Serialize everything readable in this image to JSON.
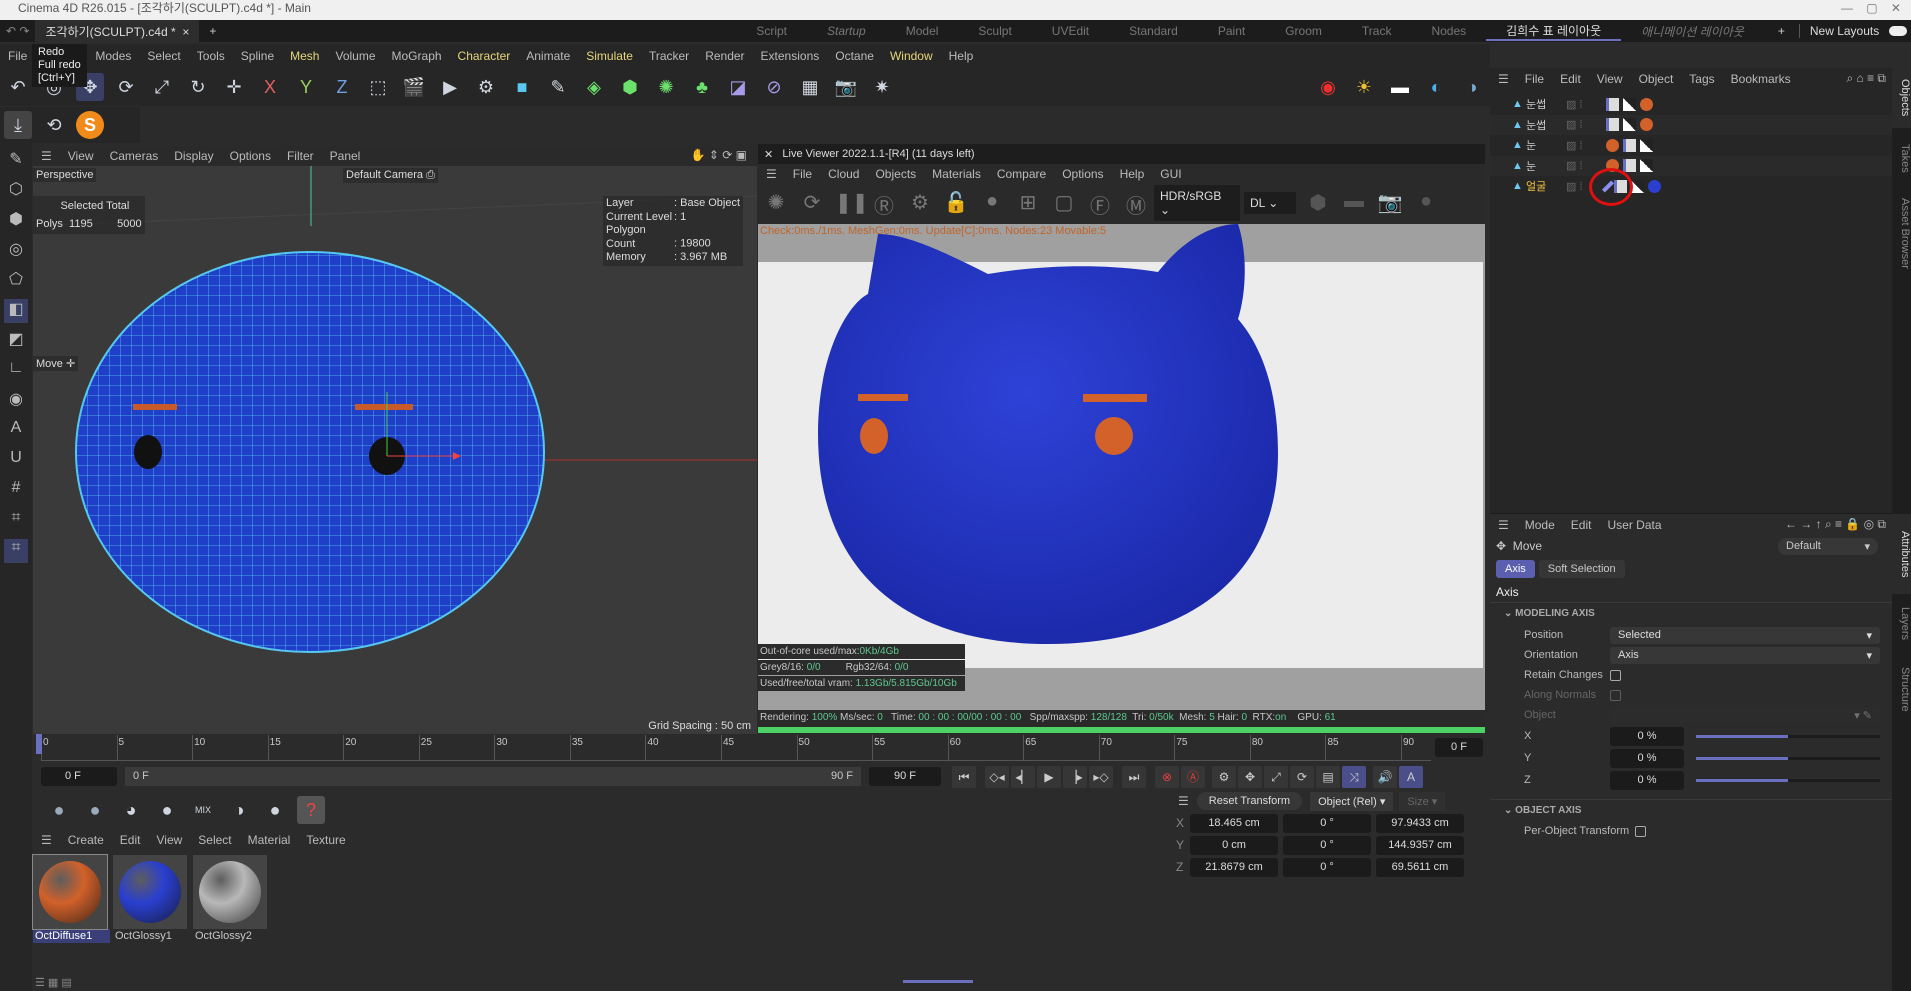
{
  "window": {
    "title": "Cinema 4D R26.015 - [조각하기(SCULPT).c4d *] - Main"
  },
  "doc_tab": {
    "label": "조각하기(SCULPT).c4d *",
    "close": "×",
    "add": "+"
  },
  "layouts": [
    "Script",
    "Startup",
    "Model",
    "Sculpt",
    "UVEdit",
    "Standard",
    "Paint",
    "Groom",
    "Track",
    "Nodes",
    "김희수 표 레이아웃",
    "애니메이션 레이아웃"
  ],
  "layout_active": "김희수 표 레이아웃",
  "new_layouts": "New Layouts",
  "tooltip": {
    "title": "Redo",
    "line1": "Full redo",
    "line2": "[Ctrl+Y]"
  },
  "menu": [
    {
      "label": "File"
    },
    {
      "label": "Create"
    },
    {
      "label": "Modes"
    },
    {
      "label": "Select"
    },
    {
      "label": "Tools"
    },
    {
      "label": "Spline"
    },
    {
      "label": "Mesh",
      "hl": true
    },
    {
      "label": "Volume"
    },
    {
      "label": "MoGraph"
    },
    {
      "label": "Character",
      "hl": true
    },
    {
      "label": "Animate"
    },
    {
      "label": "Simulate",
      "hl": true
    },
    {
      "label": "Tracker"
    },
    {
      "label": "Render"
    },
    {
      "label": "Extensions"
    },
    {
      "label": "Octane"
    },
    {
      "label": "Window",
      "hl": true
    },
    {
      "label": "Help"
    }
  ],
  "viewport": {
    "menu": [
      "View",
      "Cameras",
      "Display",
      "Options",
      "Filter",
      "Panel"
    ],
    "name": "Perspective",
    "camera": "Default Camera",
    "stats": {
      "header_selected": "Selected",
      "header_total": "Total",
      "row_label": "Polys",
      "selected": "1195",
      "total": "5000"
    },
    "info": [
      [
        "Layer",
        ": Base Object"
      ],
      [
        "Current Level",
        ": 1"
      ],
      [
        "Polygon Count",
        ": 19800"
      ],
      [
        "Memory",
        ": 3.967 MB"
      ]
    ],
    "tool": "Move",
    "grid_spacing": "Grid Spacing : 50 cm"
  },
  "live_viewer": {
    "title": "Live Viewer 2022.1.1-[R4] (11 days left)",
    "menu": [
      "File",
      "Cloud",
      "Objects",
      "Materials",
      "Compare",
      "Options",
      "Help",
      "GUI"
    ],
    "colorspace": "HDR/sRGB",
    "kernel": "DL",
    "status": "Check:0ms./1ms. MeshGen:0ms. Update[C]:0ms. Nodes:23 Movable:5",
    "mem": {
      "ooc_label": "Out-of-core used/max:",
      "ooc": "0Kb/4Gb",
      "grey_label": "Grey8/16: ",
      "grey": "0/0",
      "rgb_label": "Rgb32/64: ",
      "rgb": "0/0",
      "vram_label": "Used/free/total vram: ",
      "vram": "1.13Gb/5.815Gb/10Gb"
    },
    "stats": [
      [
        "Rendering: ",
        "100%"
      ],
      [
        " Ms/sec: ",
        "0"
      ],
      [
        "   Time: ",
        "00 : 00 : 00/00 : 00 : 00"
      ],
      [
        "   Spp/maxspp: ",
        "128/128"
      ],
      [
        "  Tri: ",
        "0/50k"
      ],
      [
        "  Mesh: ",
        "5"
      ],
      [
        " Hair: ",
        "0"
      ],
      [
        "  RTX:",
        "on"
      ],
      [
        "    GPU: ",
        "61"
      ]
    ],
    "progress": 100
  },
  "timeline": {
    "ticks": [
      "0",
      "5",
      "10",
      "15",
      "20",
      "25",
      "30",
      "35",
      "40",
      "45",
      "50",
      "55",
      "60",
      "65",
      "70",
      "75",
      "80",
      "85",
      "90"
    ],
    "current": "0 F",
    "start": "0 F",
    "range_start": "0 F",
    "range_end": "90 F",
    "end": "90 F"
  },
  "materials": {
    "menu": [
      "Create",
      "Edit",
      "View",
      "Select",
      "Material",
      "Texture"
    ],
    "items": [
      {
        "name": "OctDiffuse1",
        "color": "#d2612a",
        "selected": true
      },
      {
        "name": "OctGlossy1",
        "color": "#2a3fd0"
      },
      {
        "name": "OctGlossy2",
        "color": "#b8b8b8"
      }
    ]
  },
  "coords": {
    "reset": "Reset Transform",
    "mode": "Object (Rel)",
    "size": "Size",
    "rows": [
      {
        "axis": "X",
        "pos": "18.465 cm",
        "rot": "0 °",
        "scale": "97.9433 cm"
      },
      {
        "axis": "Y",
        "pos": "0 cm",
        "rot": "0 °",
        "scale": "144.9357 cm"
      },
      {
        "axis": "Z",
        "pos": "21.8679 cm",
        "rot": "0 °",
        "scale": "69.5611 cm"
      }
    ]
  },
  "objects": {
    "menu": [
      "File",
      "Edit",
      "View",
      "Object",
      "Tags",
      "Bookmarks"
    ],
    "items": [
      {
        "name": "눈썹"
      },
      {
        "name": "눈썹"
      },
      {
        "name": "눈"
      },
      {
        "name": "눈"
      },
      {
        "name": "얼굴",
        "active": true
      }
    ]
  },
  "attributes": {
    "menu": [
      "Mode",
      "Edit",
      "User Data"
    ],
    "tool": "Move",
    "preset": "Default",
    "tabs": [
      "Axis",
      "Soft Selection"
    ],
    "section": "Axis",
    "group1": "MODELING AXIS",
    "position_label": "Position",
    "position": "Selected",
    "orientation_label": "Orientation",
    "orientation": "Axis",
    "retain": "Retain Changes",
    "along": "Along Normals",
    "object": "Object",
    "sliders": [
      {
        "axis": "X",
        "value": "0 %",
        "level": 0.5
      },
      {
        "axis": "Y",
        "value": "0 %",
        "level": 0.5
      },
      {
        "axis": "Z",
        "value": "0 %",
        "level": 0.5
      }
    ],
    "group2": "OBJECT AXIS",
    "per_object": "Per-Object Transform"
  },
  "side_tabs": [
    "Objects",
    "Takes",
    "Asset Browser",
    "Attributes",
    "Layers",
    "Structure"
  ],
  "colors": {
    "accent": "#6a6fc0",
    "render_blue": "#2a3bc8",
    "orange": "#d2612a",
    "green": "#4cd264"
  }
}
